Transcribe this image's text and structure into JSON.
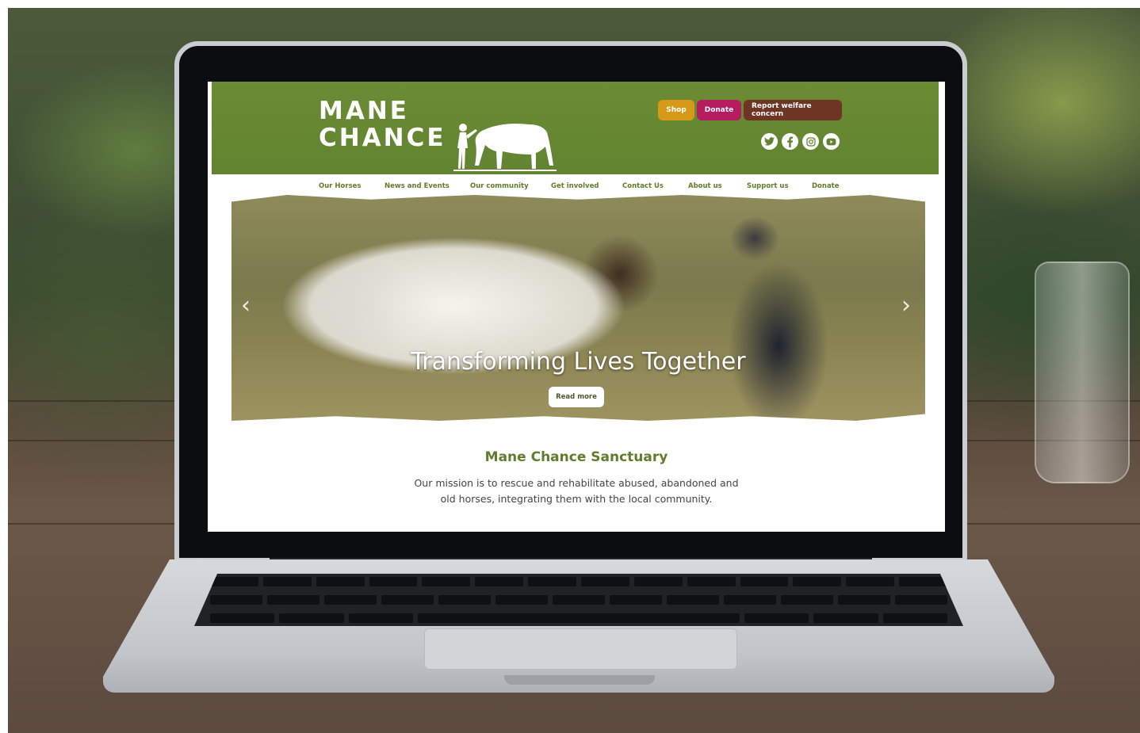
{
  "site": {
    "logo_line1": "MANE",
    "logo_line2": "CHANCE",
    "header_buttons": {
      "shop": "Shop",
      "donate": "Donate",
      "report": "Report welfare concern"
    },
    "socials": [
      "twitter-icon",
      "facebook-icon",
      "instagram-icon",
      "youtube-icon"
    ],
    "nav": [
      "Our Horses",
      "News and Events",
      "Our community",
      "Get involved",
      "Contact Us",
      "About us",
      "Support us",
      "Donate"
    ],
    "hero": {
      "title": "Transforming Lives Together",
      "button": "Read more",
      "prev_icon": "chevron-left-icon",
      "next_icon": "chevron-right-icon"
    },
    "intro": {
      "heading": "Mane Chance Sanctuary",
      "mission": "Our mission is to rescue and rehabilitate abused, abandoned and old horses, integrating them with the local community."
    }
  },
  "colors": {
    "header_green": "#6b8c34",
    "nav_green": "#5f7d2c",
    "shop": "#d79a18",
    "donate": "#b51d5f",
    "welfare": "#6e3524"
  }
}
